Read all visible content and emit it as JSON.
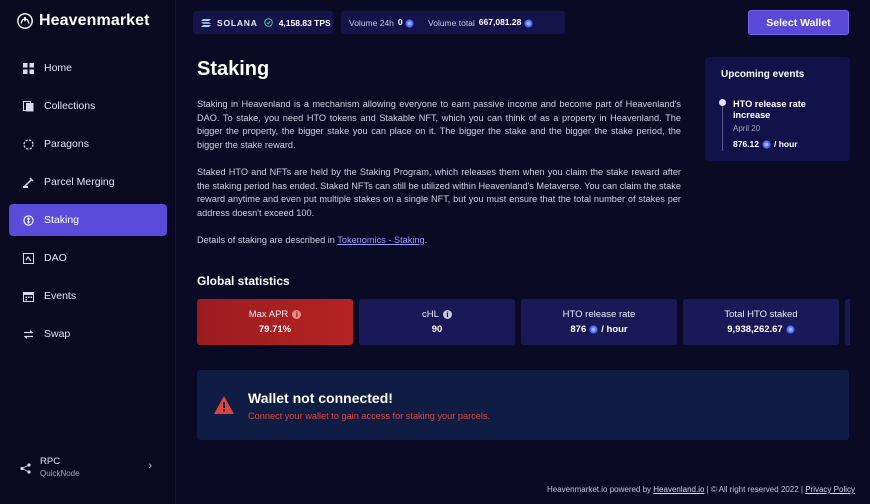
{
  "brand": {
    "name": "Heavenmarket"
  },
  "colors": {
    "accent": "#5a49d6",
    "background": "#0b0a24",
    "card": "#1a1958",
    "danger": "#e0443f",
    "apr_card": "#b52322",
    "link": "#9d97ff"
  },
  "sidebar": {
    "items": [
      {
        "label": "Home",
        "icon": "home-icon"
      },
      {
        "label": "Collections",
        "icon": "collections-icon"
      },
      {
        "label": "Paragons",
        "icon": "paragons-icon"
      },
      {
        "label": "Parcel Merging",
        "icon": "parcel-merging-icon"
      },
      {
        "label": "Staking",
        "icon": "staking-icon",
        "active": true
      },
      {
        "label": "DAO",
        "icon": "dao-icon"
      },
      {
        "label": "Events",
        "icon": "calendar-icon"
      },
      {
        "label": "Swap",
        "icon": "swap-icon"
      }
    ],
    "rpc": {
      "label": "RPC",
      "provider": "QuickNode"
    }
  },
  "topbar": {
    "network": "SOLANA",
    "tps": "4,158.83 TPS",
    "volume_24h_label": "Volume 24h",
    "volume_24h_value": "0",
    "volume_total_label": "Volume total",
    "volume_total_value": "667,081.28",
    "select_wallet": "Select Wallet"
  },
  "main": {
    "title": "Staking",
    "paragraph1": "Staking in Heavenland is a mechanism allowing everyone to earn passive income and become part of Heavenland's DAO. To stake, you need HTO tokens and Stakable NFT, which you can think of as a property in Heavenland. The bigger the property, the bigger stake you can place on it. The bigger the stake and the bigger the stake period, the bigger the stake reward.",
    "paragraph2": "Staked HTO and NFTs are held by the Staking Program, which releases them when you claim the stake reward after the staking period has ended. Staked NFTs can still be utilized within Heavenland's Metaverse. You can claim the stake reward anytime and even put multiple stakes on a single NFT, but you must ensure that the total number of stakes per address doesn't exceed 100.",
    "paragraph3_prefix": "Details of staking are described in ",
    "paragraph3_link": "Tokenomics - Staking",
    "paragraph3_suffix": ".",
    "stats_title": "Global statistics",
    "stats": [
      {
        "label": "Max APR",
        "value": "79.71%",
        "info": true
      },
      {
        "label": "cHL",
        "value": "90",
        "info": true
      },
      {
        "label": "HTO release rate",
        "value": "876",
        "suffix": "/ hour",
        "coin": true
      },
      {
        "label": "Total HTO staked",
        "value": "9,938,262.67",
        "coin": true
      }
    ],
    "alert": {
      "title": "Wallet not connected!",
      "text": "Connect your wallet to gain access for staking your parcels."
    }
  },
  "events": {
    "title": "Upcoming events",
    "items": [
      {
        "title": "HTO release rate increase",
        "date": "April 20",
        "value": "876.12",
        "suffix": "/ hour"
      }
    ]
  },
  "footer": {
    "prefix": "Heavenmarket.io powered by ",
    "link": "Heavenland.io",
    "middle": " | © All right reserved 2022 | ",
    "privacy": "Privacy Policy"
  }
}
